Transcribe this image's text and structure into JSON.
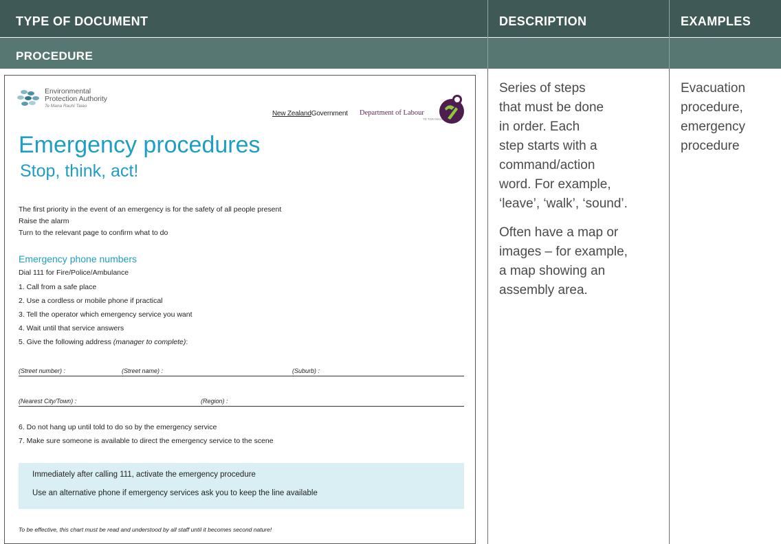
{
  "table": {
    "header": {
      "col1": "TYPE OF DOCUMENT",
      "col2": "DESCRIPTION",
      "col3": "EXAMPLES"
    },
    "row_label": "PROCEDURE",
    "description": {
      "para1_lines": [
        "Series of steps",
        "that must be done",
        "in order. Each",
        "step starts with a",
        "command/action",
        "word. For example,",
        "‘leave’, ‘walk’, ‘sound’."
      ],
      "para2_lines": [
        "Often have a map or",
        "images – for example,",
        "a map showing an",
        "assembly area."
      ]
    },
    "examples_lines": [
      "Evacuation",
      "procedure,",
      "emergency",
      "procedure"
    ]
  },
  "document": {
    "epa_name": [
      "Environmental",
      "Protection Authority"
    ],
    "epa_maori": "Te Mana Rauhī Taiao",
    "nz_gov": {
      "a": "New Zealand",
      "b": "Government"
    },
    "dol_name": "Department of Labour",
    "dol_sub": "TE TARI MAHI",
    "title": "Emergency procedures",
    "subtitle": "Stop, think, act!",
    "intro": [
      "The first priority in the event of an emergency is for the safety of all people present",
      "Raise the alarm",
      "Turn to the relevant page to confirm what to do"
    ],
    "phone_heading": "Emergency phone numbers",
    "dial": "Dial 111 for Fire/Police/Ambulance",
    "steps": [
      "1.  Call from a safe place",
      "2.  Use a cordless or mobile phone if practical",
      "3.  Tell the operator which emergency service you want",
      "4.  Wait until that service answers"
    ],
    "step5": "5.  Give the following address ",
    "step5_note": "(manager to complete)",
    "step5_end": ":",
    "fields": {
      "street_number": "(Street number) :",
      "street_name": "(Street name) :",
      "suburb": "(Suburb) :",
      "city": "(Nearest City/Town) :",
      "region": "(Region) :"
    },
    "steps2": [
      "6.  Do not hang up until told to do so by the emergency service",
      "7.  Make sure someone is available to direct the emergency service to the scene"
    ],
    "callout": [
      "Immediately after calling 111, activate the emergency procedure",
      "Use an alternative phone if emergency services ask you to keep the line available"
    ],
    "footnote": "To be effective, this chart must be read and understood by all staff until it becomes second nature!"
  }
}
